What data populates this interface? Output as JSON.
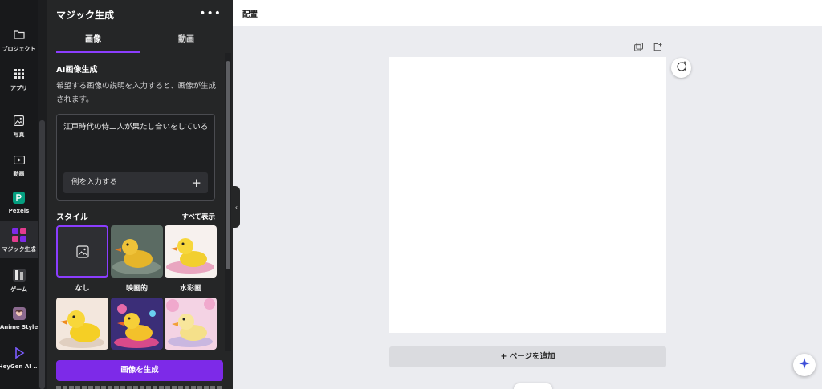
{
  "rail": {
    "items": [
      {
        "label": "プロジェクト",
        "icon": "folder-icon"
      },
      {
        "label": "アプリ",
        "icon": "apps-grid-icon"
      },
      {
        "label": "写真",
        "icon": "photo-icon"
      },
      {
        "label": "動画",
        "icon": "video-icon"
      },
      {
        "label": "Pexels",
        "icon": "pexels-icon"
      },
      {
        "label": "マジック生成",
        "icon": "magic-media-icon"
      },
      {
        "label": "ゲーム",
        "icon": "game-icon"
      },
      {
        "label": "Anime Style",
        "icon": "anime-style-icon"
      },
      {
        "label": "HeyGen AI ...",
        "icon": "heygen-icon"
      }
    ],
    "active_index": 5
  },
  "panel": {
    "title": "マジック生成",
    "more": "•••",
    "tabs": [
      {
        "label": "画像"
      },
      {
        "label": "動画"
      }
    ],
    "section_title": "AI画像生成",
    "description": "希望する画像の説明を入力すると、画像が生成されます。",
    "prompt_value": "江戸時代の侍二人が果たし合いをしている",
    "example_button": "例を入力する",
    "style_title": "スタイル",
    "show_all": "すべて表示",
    "styles": [
      {
        "label": "なし",
        "selected": true
      },
      {
        "label": "映画的"
      },
      {
        "label": "水彩画"
      }
    ],
    "generate_button": "画像を生成"
  },
  "canvas": {
    "topbar_label": "配置",
    "add_page": "+ ページを追加"
  },
  "colors": {
    "accent": "#8b3dff",
    "generate": "#7d2ae8",
    "rail_bg": "#18191b",
    "panel_bg": "#252627",
    "canvas_bg": "#ebecf0"
  }
}
